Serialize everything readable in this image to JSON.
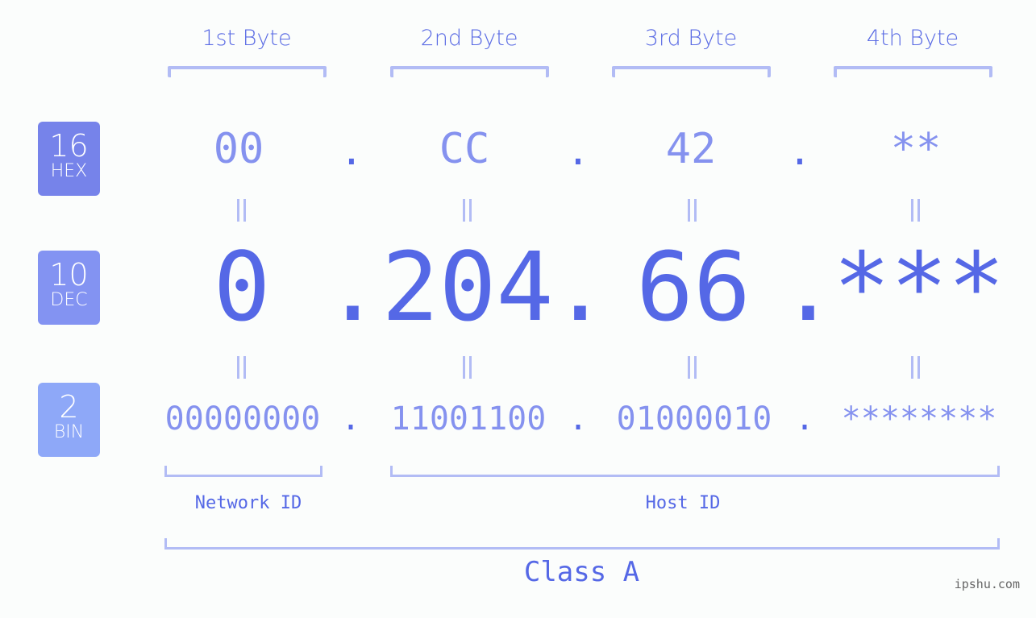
{
  "byte_headers": [
    "1st Byte",
    "2nd Byte",
    "3rd Byte",
    "4th Byte"
  ],
  "bases": [
    {
      "num": "16",
      "label": "HEX",
      "color": "#7683ea"
    },
    {
      "num": "10",
      "label": "DEC",
      "color": "#8393f2"
    },
    {
      "num": "2",
      "label": "BIN",
      "color": "#8ea8f8"
    }
  ],
  "hex": [
    "00",
    "CC",
    "42",
    "**"
  ],
  "dec": [
    "0",
    "204",
    "66",
    "***"
  ],
  "bin": [
    "00000000",
    "11001100",
    "01000010",
    "********"
  ],
  "separator": ".",
  "equals": "=",
  "network_id_label": "Network ID",
  "host_id_label": "Host ID",
  "class_label": "Class A",
  "watermark": "ipshu.com",
  "colors": {
    "primary": "#5568e6",
    "secondary": "#8592ef",
    "bracket": "#b2bcf5",
    "background": "#fbfdfc"
  }
}
